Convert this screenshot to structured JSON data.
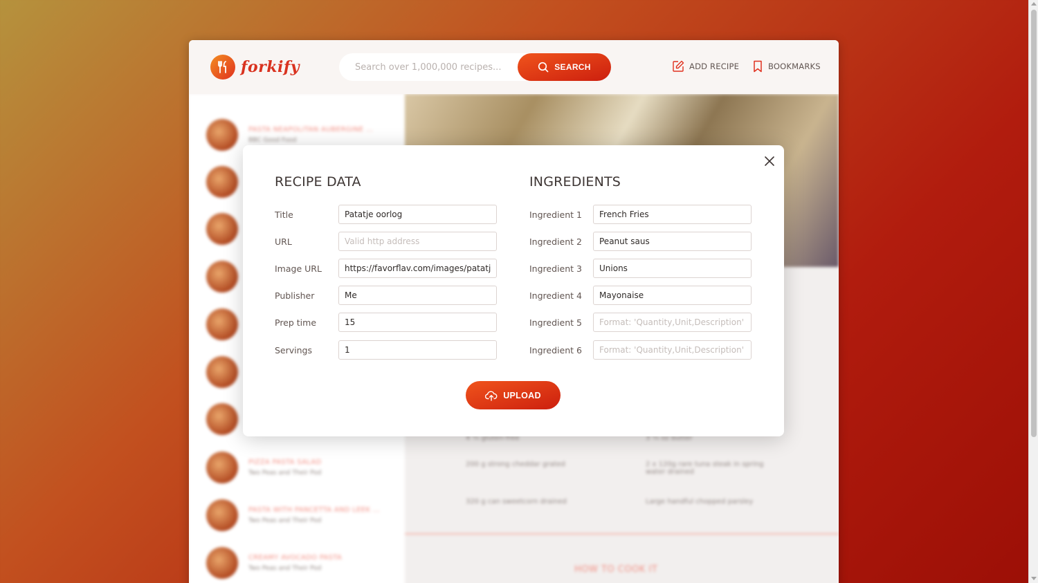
{
  "app": {
    "name": "forkify"
  },
  "search": {
    "placeholder": "Search over 1,000,000 recipes...",
    "button_label": "SEARCH"
  },
  "nav": {
    "add_recipe": "ADD RECIPE",
    "bookmarks": "BOOKMARKS"
  },
  "background": {
    "results": [
      {
        "title": "Pasta Neapolitan Aubergine ...",
        "publisher": "BBC Good Food"
      },
      {
        "title": "",
        "publisher": ""
      },
      {
        "title": "",
        "publisher": ""
      },
      {
        "title": "",
        "publisher": ""
      },
      {
        "title": "",
        "publisher": ""
      },
      {
        "title": "",
        "publisher": ""
      },
      {
        "title": "",
        "publisher": ""
      },
      {
        "title": "Pizza Pasta Salad",
        "publisher": "Two Peas and Their Pod"
      },
      {
        "title": "Pasta with Pancetta and Leek ...",
        "publisher": "Two Peas and Their Pod"
      },
      {
        "title": "Creamy Avocado Pasta",
        "publisher": "Two Peas and Their Pod"
      }
    ],
    "ingredients": [
      "4 ¼ gluten-free",
      "3 ¼ oz butter",
      "200 g strong cheddar grated",
      "2 x 120g rare tuna steak in spring water drained",
      "320 g can sweetcorn drained",
      "Large handful chopped parsley"
    ],
    "how_to_cook": "HOW TO COOK IT"
  },
  "modal": {
    "recipe_section_title": "RECIPE DATA",
    "ingredients_section_title": "INGREDIENTS",
    "recipe_fields": [
      {
        "label": "Title",
        "value": "Patatje oorlog",
        "placeholder": ""
      },
      {
        "label": "URL",
        "value": "",
        "placeholder": "Valid http address"
      },
      {
        "label": "Image URL",
        "value": "https://favorflav.com/images/patatje-oorlog",
        "placeholder": ""
      },
      {
        "label": "Publisher",
        "value": "Me",
        "placeholder": ""
      },
      {
        "label": "Prep time",
        "value": "15",
        "placeholder": ""
      },
      {
        "label": "Servings",
        "value": "1",
        "placeholder": ""
      }
    ],
    "ingredient_fields": [
      {
        "label": "Ingredient 1",
        "value": "French Fries",
        "placeholder": ""
      },
      {
        "label": "Ingredient 2",
        "value": "Peanut saus",
        "placeholder": ""
      },
      {
        "label": "Ingredient 3",
        "value": "Unions",
        "placeholder": ""
      },
      {
        "label": "Ingredient 4",
        "value": "Mayonaise",
        "placeholder": ""
      },
      {
        "label": "Ingredient 5",
        "value": "",
        "placeholder": "Format: 'Quantity,Unit,Description'"
      },
      {
        "label": "Ingredient 6",
        "value": "",
        "placeholder": "Format: 'Quantity,Unit,Description'"
      }
    ],
    "upload_label": "UPLOAD"
  },
  "colors": {
    "accent": "#e0301e",
    "accent_light": "#f0541c",
    "text": "#615551"
  }
}
